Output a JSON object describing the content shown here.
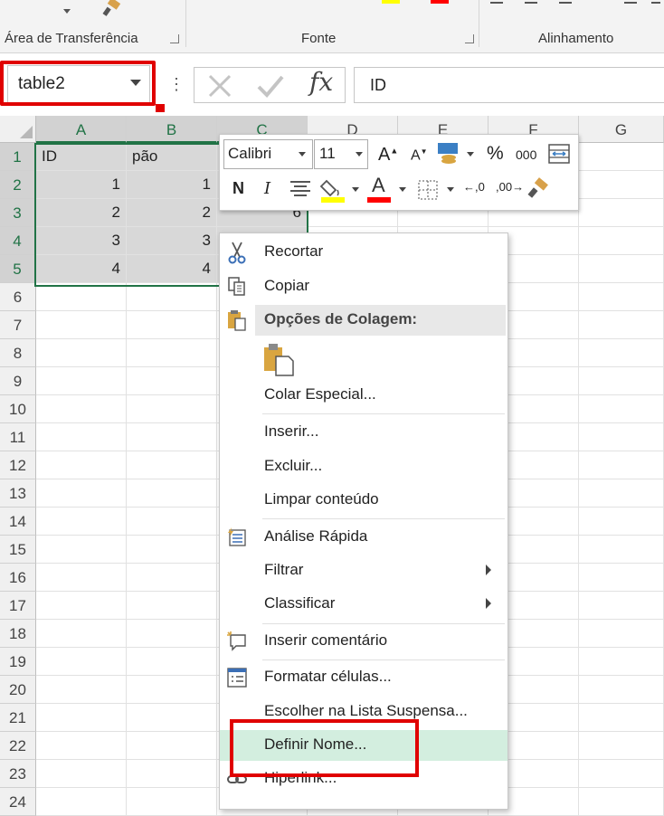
{
  "ribbon": {
    "groups": [
      {
        "label": "Área de Transferência"
      },
      {
        "label": "Fonte"
      },
      {
        "label": "Alinhamento"
      }
    ]
  },
  "formula_bar": {
    "name_box": "table2",
    "formula": "ID",
    "fx_label": "fx"
  },
  "grid": {
    "columns": [
      "A",
      "B",
      "C",
      "D",
      "E",
      "F",
      "G"
    ],
    "rows": [
      "1",
      "2",
      "3",
      "4",
      "5",
      "6",
      "7",
      "8",
      "9",
      "10",
      "11",
      "12",
      "13",
      "14",
      "15",
      "16",
      "17",
      "18",
      "19",
      "20",
      "21",
      "22",
      "23",
      "24"
    ],
    "cells": {
      "A1": "ID",
      "B1": "pão",
      "A2": "1",
      "B2": "1",
      "A3": "2",
      "B3": "2",
      "C3": "6",
      "A4": "3",
      "B4": "3",
      "A5": "4",
      "B5": "4"
    }
  },
  "mini_toolbar": {
    "font_name": "Calibri",
    "font_size": "11",
    "bold": "N",
    "italic": "I",
    "percent": "%",
    "thousands": "000",
    "font_color": "#ff0000",
    "fill_color": "#ffff00"
  },
  "context_menu": {
    "items": [
      {
        "label": "Recortar",
        "icon": "scissors-icon"
      },
      {
        "label": "Copiar",
        "icon": "copy-icon"
      },
      {
        "label": "Opções de Colagem:",
        "icon": "paste-icon"
      },
      {
        "label": "Colar Especial..."
      },
      {
        "label": "Inserir..."
      },
      {
        "label": "Excluir..."
      },
      {
        "label": "Limpar conteúdo"
      },
      {
        "label": "Análise Rápida",
        "icon": "quick-analysis-icon"
      },
      {
        "label": "Filtrar"
      },
      {
        "label": "Classificar"
      },
      {
        "label": "Inserir comentário",
        "icon": "comment-icon"
      },
      {
        "label": "Formatar células...",
        "icon": "format-cells-icon"
      },
      {
        "label": "Escolher na Lista Suspensa..."
      },
      {
        "label": "Definir Nome..."
      },
      {
        "label": "Hiperlink...",
        "icon": "link-icon"
      }
    ]
  },
  "colors": {
    "excel_green": "#217346",
    "annotation_red": "#e00000",
    "hover_green": "#d3eedf"
  }
}
